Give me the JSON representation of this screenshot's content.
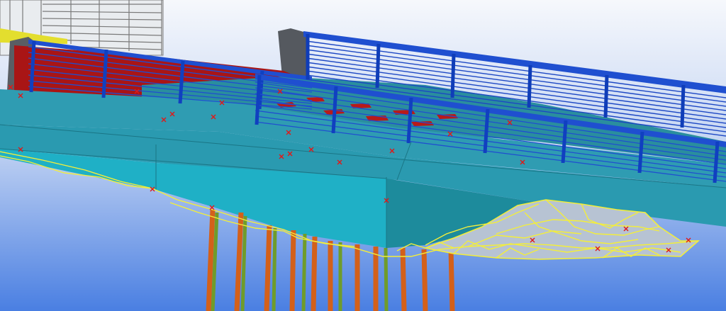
{
  "viewport": {
    "background_top": "#f4f6fb",
    "background_bottom": "#4f80e0"
  },
  "model": {
    "element_colors": {
      "deck_side": "#2f9bb0",
      "deck_underside": "#1fa9bf",
      "deck_top_grey": "#6f8f95",
      "deck_red_zone": "#b01616",
      "railing": "#1f4fd0",
      "railing_dark": "#0d2e9a",
      "pile_orange": "#d4621a",
      "pile_green": "#6a9a2a",
      "terrain_mesh": "#f5f03a",
      "terrain_fill": "#b8c4d4",
      "marker": "#e01818",
      "building_frame": "#8a8a8a",
      "building_yellow": "#e6e23a",
      "abutment_grey": "#555a60"
    }
  }
}
